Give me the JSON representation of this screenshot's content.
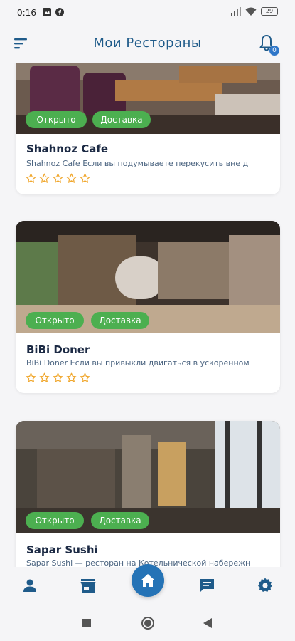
{
  "status": {
    "time": "0:16",
    "battery": "29"
  },
  "header": {
    "title": "Мои Рестораны",
    "notifications": "0"
  },
  "restaurants": [
    {
      "name": "Shahnoz Cafe",
      "description": "Shahnoz Cafe Если вы подумываете перекусить вне д",
      "tags": [
        "Открыто",
        "Доставка"
      ],
      "rating": 0
    },
    {
      "name": "BiBi Doner",
      "description": "BiBi Doner Если вы привыкли двигаться в ускоренном",
      "tags": [
        "Открыто",
        "Доставка"
      ],
      "rating": 0
    },
    {
      "name": "Sapar Sushi",
      "description": "Sapar Sushi — ресторан на Котельнической набережн",
      "tags": [
        "Открыто",
        "Доставка"
      ],
      "rating": 0
    }
  ],
  "bottom_nav": [
    "profile-icon",
    "store-icon",
    "home-icon",
    "chat-icon",
    "settings-icon"
  ],
  "colors": {
    "accent": "#2573b6",
    "tag": "#4caf50",
    "star": "#f0a830",
    "title": "#1f5b8a"
  }
}
